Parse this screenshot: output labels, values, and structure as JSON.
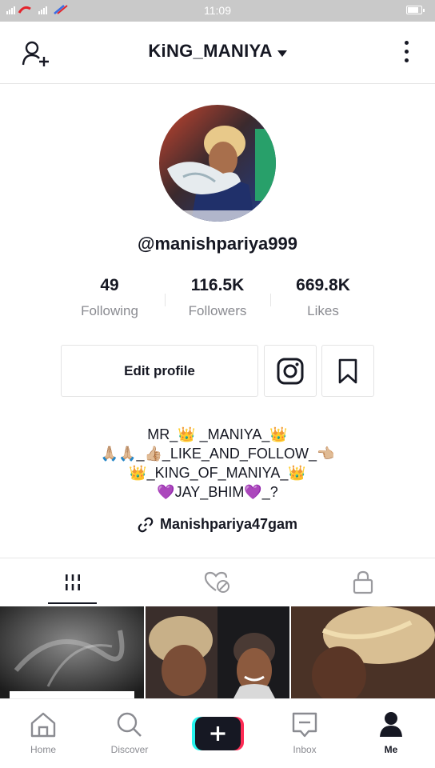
{
  "status_bar": {
    "time": "11:09",
    "carrier": "4G",
    "battery_level": 0.85
  },
  "header": {
    "title": "KiNG_MANIYA"
  },
  "profile": {
    "username": "@manishpariya999",
    "stats": [
      {
        "value": "49",
        "label": "Following"
      },
      {
        "value": "116.5K",
        "label": "Followers"
      },
      {
        "value": "669.8K",
        "label": "Likes"
      }
    ],
    "edit_label": "Edit profile",
    "bio": [
      "MR_👑 _MANIYA_👑",
      "🙏🏼🙏🏼_👍🏼_LIKE_AND_FOLLOW_👈🏼",
      "👑_KING_OF_MANIYA_👑",
      "💜JAY_BHIM💜_?"
    ],
    "link": "Manishpariya47gam"
  },
  "tabs": [
    "videos",
    "liked",
    "private"
  ],
  "nav": {
    "items": [
      {
        "label": "Home",
        "icon": "home-icon"
      },
      {
        "label": "Discover",
        "icon": "search-icon"
      },
      {
        "label": "",
        "icon": "plus-icon"
      },
      {
        "label": "Inbox",
        "icon": "inbox-icon"
      },
      {
        "label": "Me",
        "icon": "profile-icon"
      }
    ]
  },
  "colors": {
    "text": "#161823",
    "muted": "#8a8b91",
    "cyan": "#25f4ee",
    "pink": "#fe2c55"
  }
}
